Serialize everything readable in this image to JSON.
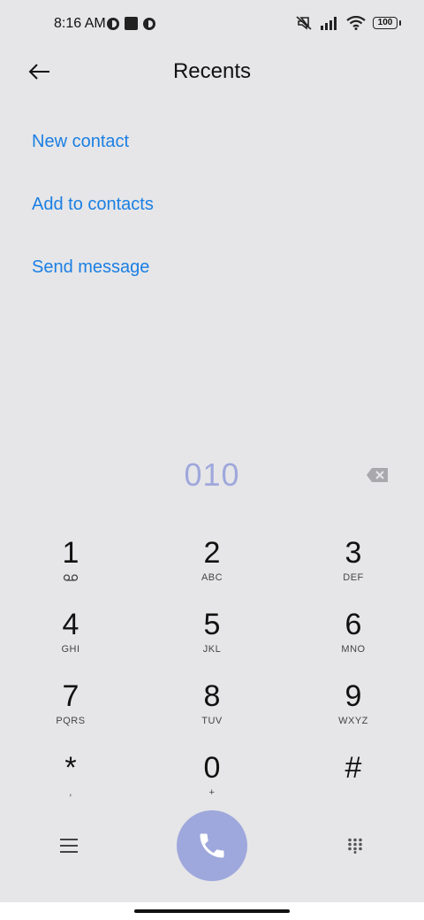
{
  "status_bar": {
    "time": "8:16 AM",
    "battery": "100",
    "icons": [
      "notification-ring-icon",
      "square-icon",
      "notification-ring-icon",
      "mute-icon",
      "signal-icon",
      "wifi-icon",
      "battery-icon"
    ]
  },
  "header": {
    "title": "Recents",
    "back_icon": "arrow-left-icon"
  },
  "actions": {
    "new_contact": "New contact",
    "add_to_contacts": "Add to contacts",
    "send_message": "Send message"
  },
  "dialer": {
    "number": "010",
    "delete_icon": "backspace-icon"
  },
  "keypad": {
    "keys": [
      {
        "digit": "1",
        "sub": ""
      },
      {
        "digit": "2",
        "sub": "ABC"
      },
      {
        "digit": "3",
        "sub": "DEF"
      },
      {
        "digit": "4",
        "sub": "GHI"
      },
      {
        "digit": "5",
        "sub": "JKL"
      },
      {
        "digit": "6",
        "sub": "MNO"
      },
      {
        "digit": "7",
        "sub": "PQRS"
      },
      {
        "digit": "8",
        "sub": "TUV"
      },
      {
        "digit": "9",
        "sub": "WXYZ"
      },
      {
        "digit": "*",
        "sub": ","
      },
      {
        "digit": "0",
        "sub": "+"
      },
      {
        "digit": "#",
        "sub": ""
      }
    ]
  },
  "bottom_bar": {
    "menu_icon": "hamburger-menu-icon",
    "call_icon": "phone-icon",
    "dialpad_icon": "dialpad-icon"
  },
  "colors": {
    "accent_link": "#1b7fe3",
    "dial_accent": "#9fa8dc",
    "background": "#e6e6e8"
  }
}
